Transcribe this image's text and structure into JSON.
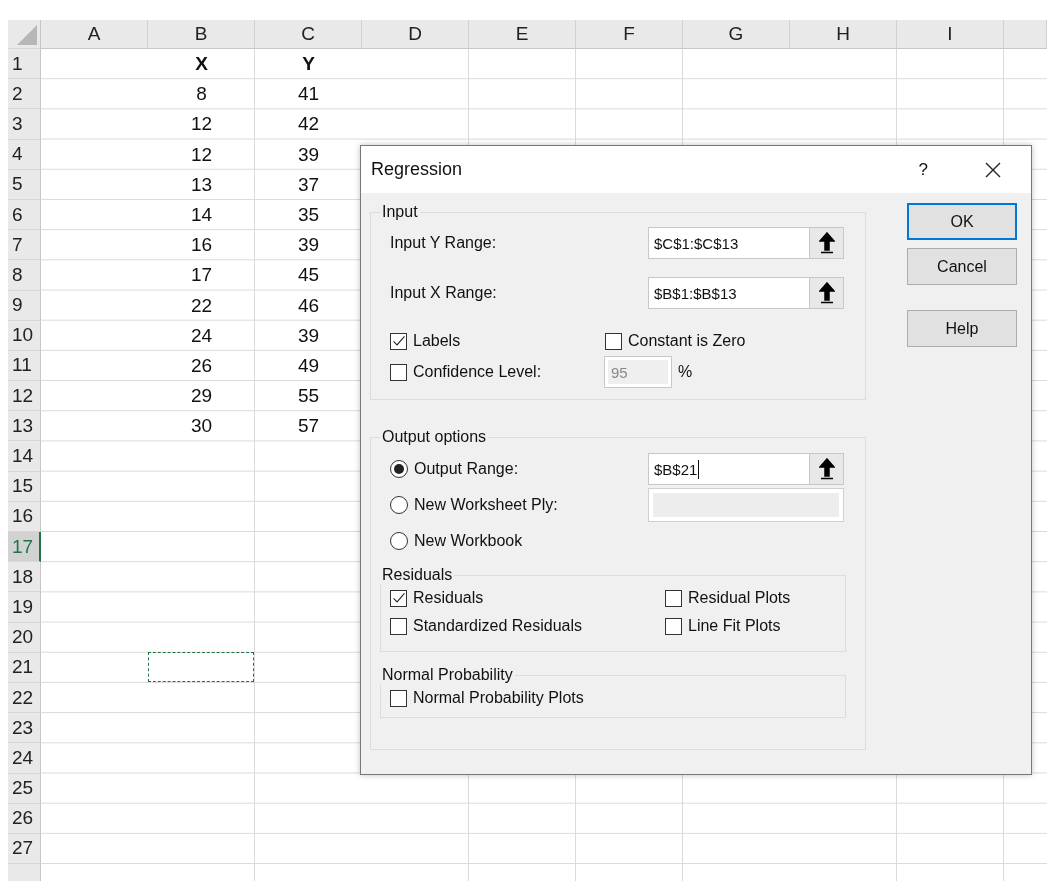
{
  "sheet": {
    "columns": [
      {
        "label": "A"
      },
      {
        "label": "B"
      },
      {
        "label": "C"
      },
      {
        "label": "D"
      },
      {
        "label": "E"
      },
      {
        "label": "F"
      },
      {
        "label": "G"
      },
      {
        "label": "H"
      },
      {
        "label": "I"
      }
    ],
    "rows": [
      {
        "number": "1",
        "selected": false,
        "bold": true,
        "b": "X",
        "c": "Y"
      },
      {
        "number": "2",
        "selected": false,
        "bold": false,
        "b": "8",
        "c": "41"
      },
      {
        "number": "3",
        "selected": false,
        "bold": false,
        "b": "12",
        "c": "42"
      },
      {
        "number": "4",
        "selected": false,
        "bold": false,
        "b": "12",
        "c": "39"
      },
      {
        "number": "5",
        "selected": false,
        "bold": false,
        "b": "13",
        "c": "37"
      },
      {
        "number": "6",
        "selected": false,
        "bold": false,
        "b": "14",
        "c": "35"
      },
      {
        "number": "7",
        "selected": false,
        "bold": false,
        "b": "16",
        "c": "39"
      },
      {
        "number": "8",
        "selected": false,
        "bold": false,
        "b": "17",
        "c": "45"
      },
      {
        "number": "9",
        "selected": false,
        "bold": false,
        "b": "22",
        "c": "46"
      },
      {
        "number": "10",
        "selected": false,
        "bold": false,
        "b": "24",
        "c": "39"
      },
      {
        "number": "11",
        "selected": false,
        "bold": false,
        "b": "26",
        "c": "49"
      },
      {
        "number": "12",
        "selected": false,
        "bold": false,
        "b": "29",
        "c": "55"
      },
      {
        "number": "13",
        "selected": false,
        "bold": false,
        "b": "30",
        "c": "57"
      },
      {
        "number": "14",
        "selected": false
      },
      {
        "number": "15",
        "selected": false
      },
      {
        "number": "16",
        "selected": false
      },
      {
        "number": "17",
        "selected": true
      },
      {
        "number": "18",
        "selected": false
      },
      {
        "number": "19",
        "selected": false
      },
      {
        "number": "20",
        "selected": false
      },
      {
        "number": "21",
        "selected": false,
        "marquee": true
      },
      {
        "number": "22",
        "selected": false
      },
      {
        "number": "23",
        "selected": false
      },
      {
        "number": "24",
        "selected": false
      },
      {
        "number": "25",
        "selected": false
      },
      {
        "number": "26",
        "selected": false
      },
      {
        "number": "27",
        "selected": false
      }
    ]
  },
  "dialog": {
    "title": "Regression",
    "help": "?",
    "input": {
      "legend": "Input",
      "fields": [
        {
          "label": "Input Y Range:",
          "value": "$C$1:$C$13"
        },
        {
          "label": "Input X Range:",
          "value": "$B$1:$B$13"
        }
      ],
      "options": [
        {
          "label": "Labels",
          "checked": true
        },
        {
          "label": "Constant is Zero",
          "checked": false
        }
      ],
      "confidence": {
        "label": "Confidence Level:",
        "checked": false,
        "value": "95",
        "disabled": true,
        "unit": "%"
      }
    },
    "output": {
      "legend": "Output options",
      "choices": [
        {
          "label": "Output Range:",
          "selected": true,
          "kind": "range",
          "value": "$B$21"
        },
        {
          "label": "New Worksheet Ply:",
          "selected": false,
          "kind": "text"
        },
        {
          "label": "New Workbook",
          "selected": false,
          "kind": "none"
        }
      ],
      "residuals": {
        "legend": "Residuals",
        "options": [
          {
            "label": "Residuals",
            "checked": true
          },
          {
            "label": "Residual Plots",
            "checked": false
          },
          {
            "label": "Standardized Residuals",
            "checked": false
          },
          {
            "label": "Line Fit Plots",
            "checked": false
          }
        ]
      },
      "normal": {
        "legend": "Normal Probability",
        "options": [
          {
            "label": "Normal Probability Plots",
            "checked": false
          }
        ]
      }
    },
    "buttons": [
      {
        "label": "OK",
        "default": true
      },
      {
        "label": "Cancel",
        "default": false
      },
      {
        "label": "Help",
        "default": false
      }
    ]
  }
}
